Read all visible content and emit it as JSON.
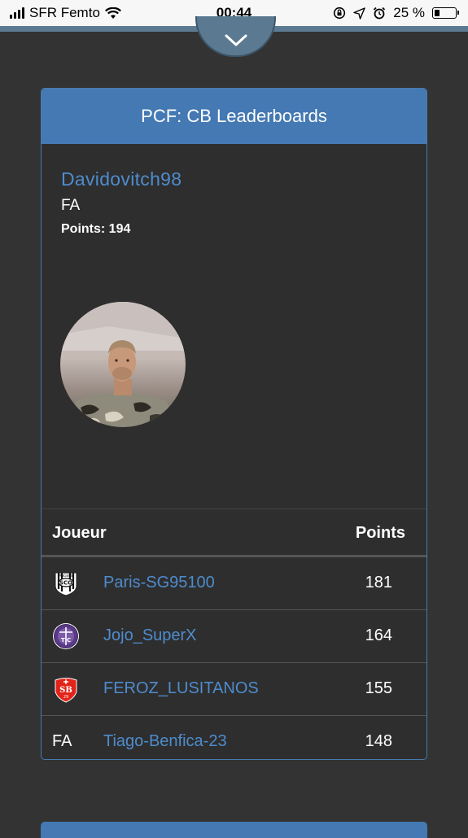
{
  "status_bar": {
    "carrier": "SFR Femto",
    "time": "00:44",
    "battery_text": "25 %",
    "battery_level": 0.25
  },
  "card": {
    "title": "PCF: CB Leaderboards",
    "profile": {
      "name": "Davidovitch98",
      "team": "FA",
      "points_label": "Points: 194"
    },
    "table": {
      "headers": {
        "player": "Joueur",
        "points": "Points"
      },
      "rows": [
        {
          "badge": "angers-sco-badge-icon",
          "team_text": "",
          "player": "Paris-SG95100",
          "points": "181"
        },
        {
          "badge": "toulouse-fc-badge-icon",
          "team_text": "",
          "player": "Jojo_SuperX",
          "points": "164"
        },
        {
          "badge": "stade-brestois-badge-icon",
          "team_text": "",
          "player": "FEROZ_LUSITANOS",
          "points": "155"
        },
        {
          "badge": "",
          "team_text": "FA",
          "player": "Tiago-Benfica-23",
          "points": "148"
        }
      ]
    }
  },
  "colors": {
    "accent": "#4479b3",
    "link": "#4e8ccd",
    "background": "#333333",
    "card_bg": "#2e2e2e"
  }
}
